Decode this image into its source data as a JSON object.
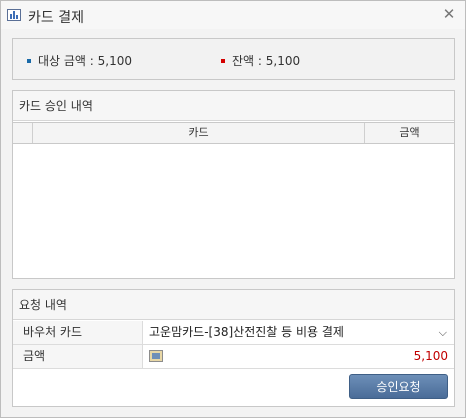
{
  "window": {
    "title": "카드 결제"
  },
  "summary": {
    "target_label": "대상 금액",
    "target_value": "5,100",
    "balance_label": "잔액",
    "balance_value": "5,100",
    "colors": {
      "target_dot": "#1a6aa8",
      "balance_dot": "#d40000"
    }
  },
  "approval": {
    "title": "카드 승인 내역",
    "columns": [
      "카드",
      "금액"
    ],
    "rows": []
  },
  "request": {
    "title": "요청 내역",
    "voucher_label": "바우처 카드",
    "voucher_value": "고운맘카드-[38]산전진찰 등 비용 결제",
    "amount_label": "금액",
    "amount_value": "5,100",
    "submit_label": "승인요청"
  }
}
